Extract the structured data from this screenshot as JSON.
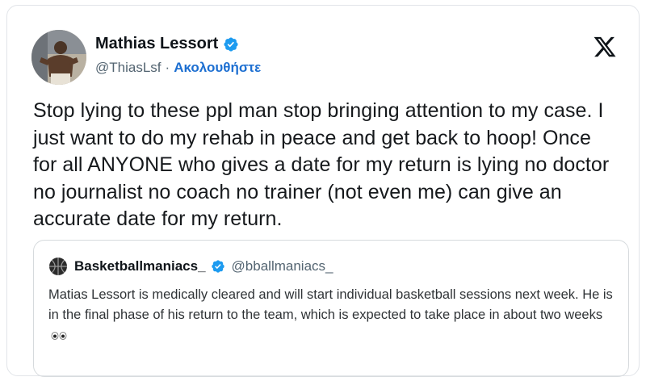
{
  "tweet": {
    "author": {
      "display_name": "Mathias Lessort",
      "handle": "@ThiasLsf",
      "separator": "·",
      "follow_label": "Ακολουθήστε",
      "verified": true,
      "avatar_icon": "player-avatar-photo"
    },
    "platform_icon": "x-logo-icon",
    "text": "Stop lying to these ppl man stop bringing attention to my case. I just want to do my rehab in peace and get back to hoop! Once for all ANYONE who gives a date for my return is lying no doctor no journalist no coach no trainer (not even me) can give an accurate date for my return.",
    "quoted": {
      "display_name": "Basketballmaniacs_",
      "handle": "@bballmaniacs_",
      "verified": true,
      "avatar_icon": "basketball-icon",
      "text": "Matias Lessort is medically cleared and will start individual basketball sessions next week. He is in the final phase of his return to the team, which is expected to take place in about two weeks",
      "emoji_icon": "eyes-emoji-icon"
    }
  },
  "colors": {
    "accent_blue": "#1d6fd1",
    "verified_blue": "#1d9bf0",
    "text_primary": "#0f1419",
    "text_secondary": "#536471",
    "border": "#d6dadd"
  }
}
